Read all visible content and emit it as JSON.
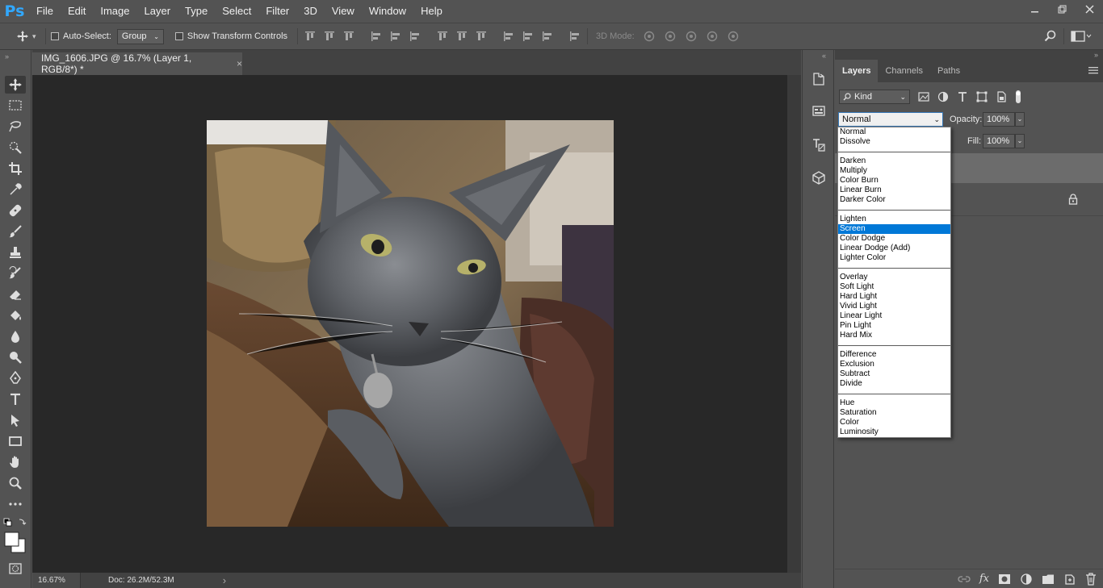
{
  "app": {
    "logo": "Ps",
    "menu": [
      "File",
      "Edit",
      "Image",
      "Layer",
      "Type",
      "Select",
      "Filter",
      "3D",
      "View",
      "Window",
      "Help"
    ]
  },
  "options_bar": {
    "auto_select_label": "Auto-Select:",
    "auto_select_target": "Group",
    "show_transform_label": "Show Transform Controls",
    "mode_3d_label": "3D Mode:"
  },
  "document": {
    "tab_title": "IMG_1606.JPG @ 16.7% (Layer 1, RGB/8*) *",
    "close_glyph": "×",
    "zoom": "16.67%",
    "doc_info": "Doc: 26.2M/52.3M",
    "arrow": "›"
  },
  "layers_panel": {
    "tabs": [
      "Layers",
      "Channels",
      "Paths"
    ],
    "kind_label": "Kind",
    "blend_mode": "Normal",
    "opacity_label": "Opacity:",
    "opacity_value": "100%",
    "fill_label": "Fill:",
    "fill_value": "100%"
  },
  "blend_dropdown": {
    "groups": [
      [
        "Normal",
        "Dissolve"
      ],
      [
        "Darken",
        "Multiply",
        "Color Burn",
        "Linear Burn",
        "Darker Color"
      ],
      [
        "Lighten",
        "Screen",
        "Color Dodge",
        "Linear Dodge (Add)",
        "Lighter Color"
      ],
      [
        "Overlay",
        "Soft Light",
        "Hard Light",
        "Vivid Light",
        "Linear Light",
        "Pin Light",
        "Hard Mix"
      ],
      [
        "Difference",
        "Exclusion",
        "Subtract",
        "Divide"
      ],
      [
        "Hue",
        "Saturation",
        "Color",
        "Luminosity"
      ]
    ],
    "highlighted": "Screen"
  },
  "colors": {
    "accent": "#0078d7",
    "ps_logo": "#31a8ff",
    "ui_bg": "#535353",
    "canvas_bg": "#282828"
  }
}
